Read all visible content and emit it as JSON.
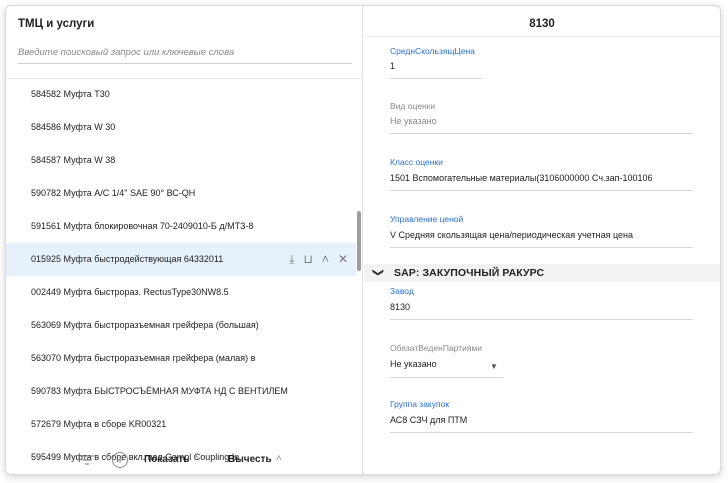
{
  "left": {
    "title": "ТМЦ и услуги",
    "search_placeholder": "Введите поисковый запрос или ключевые слова",
    "items": [
      {
        "label": "584582 Муфта Т30"
      },
      {
        "label": "584586 Муфта W 30"
      },
      {
        "label": "584587 Муфта W 38"
      },
      {
        "label": "590782 Муфта А/С 1/4\" SAE 90° ВС-QН"
      },
      {
        "label": "591561 Муфта блокировочная 70-2409010-Б д/МТЗ-8"
      },
      {
        "label": "015925 Муфта быстродействующая 64332011",
        "selected": true
      },
      {
        "label": "002449 Муфта быстрораз. RectusType30NW8.5"
      },
      {
        "label": "563069 Муфта быстроразъемная грейфера (большая)"
      },
      {
        "label": "563070 Муфта быстроразъемная грейфера (малая) в"
      },
      {
        "label": "590783 Муфта БЫСТРОСЪЁМНАЯ МУФТА НД С ВЕНТИЛЕМ"
      },
      {
        "label": "572679 Муфта в сборе KR00321"
      },
      {
        "label": "595499 Муфта в сборе вкл. вал Compl Coupling In"
      }
    ],
    "bottom": {
      "show_label": "Показать",
      "calc_label": "Вычесть"
    }
  },
  "right": {
    "title": "8130",
    "fields": {
      "avg_price_label": "СреднСкользящЦена",
      "avg_price_value": "1",
      "valuation_type_label": "Вид оценки",
      "valuation_type_value": "Не указано",
      "valuation_class_label": "Класс оценки",
      "valuation_class_value": "1501 Вспомогательные материалы(3106000000 Сч.зап-100106",
      "price_control_label": "Управление ценой",
      "price_control_value": "V Средняя скользящая цена/периодическая учетная цена",
      "plant_label": "Завод",
      "plant_value": "8130",
      "batch_mgmt_label": "ОбязатВеденПартиями",
      "batch_mgmt_value": "Не указано",
      "purchasing_group_label": "Группа закупок",
      "purchasing_group_value": "АС8 СЗЧ для ПТМ"
    },
    "section_title": "SAP: ЗАКУПОЧНЫЙ РАКУРС"
  }
}
